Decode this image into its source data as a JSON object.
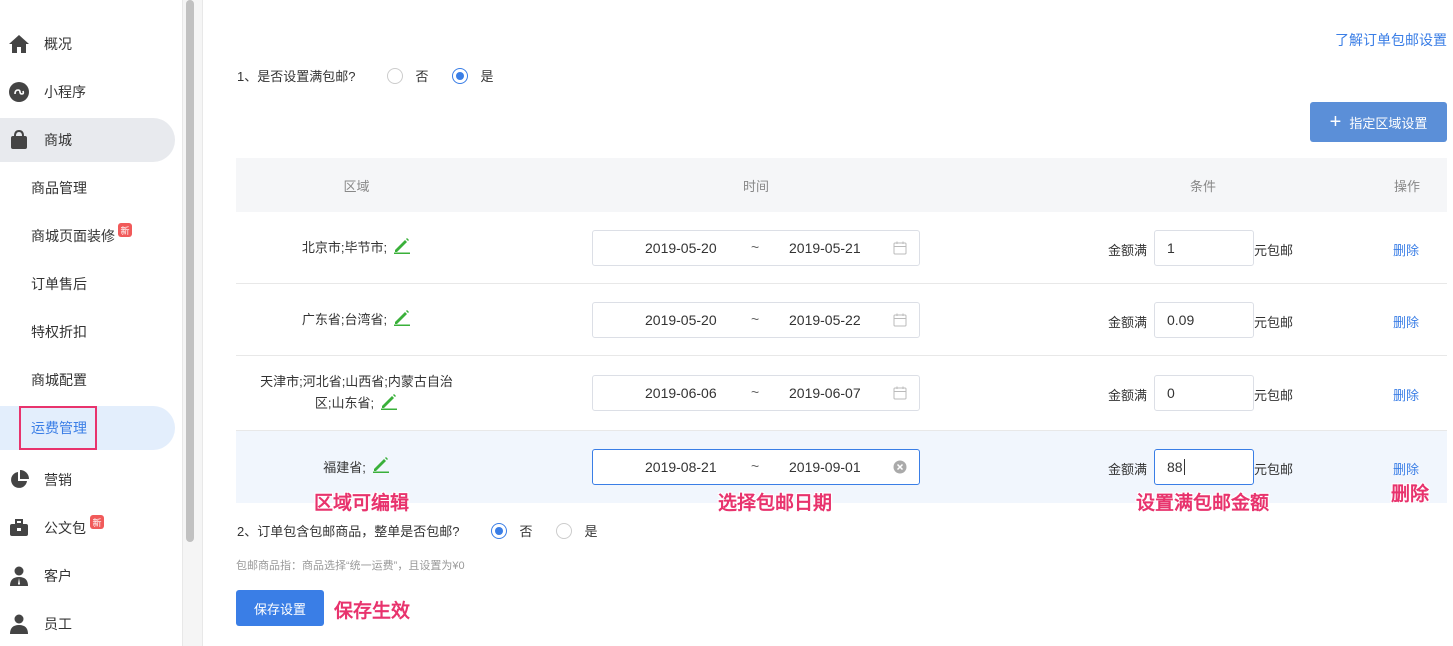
{
  "sidebar": {
    "items": [
      {
        "label": "概况",
        "icon": "home-icon"
      },
      {
        "label": "小程序",
        "icon": "miniprogram-icon"
      },
      {
        "label": "商城",
        "icon": "shopping-bag-icon"
      },
      {
        "label": "商品管理"
      },
      {
        "label": "商城页面装修",
        "badge": "新"
      },
      {
        "label": "订单售后"
      },
      {
        "label": "特权折扣"
      },
      {
        "label": "商城配置"
      },
      {
        "label": "运费管理"
      },
      {
        "label": "营销",
        "icon": "pie-chart-icon"
      },
      {
        "label": "公文包",
        "badge": "新",
        "icon": "briefcase-icon"
      },
      {
        "label": "客户",
        "icon": "customer-icon"
      },
      {
        "label": "员工",
        "icon": "employee-icon"
      }
    ]
  },
  "header": {
    "help_link": "了解订单包邮设置"
  },
  "q1": {
    "label": "1、是否设置满包邮?",
    "opt_no": "否",
    "opt_yes": "是",
    "selected": "是"
  },
  "add_region_button": "指定区域设置",
  "table": {
    "headers": {
      "region": "区域",
      "time": "时间",
      "condition": "条件",
      "action": "操作"
    },
    "rows": [
      {
        "region": "北京市;毕节市;",
        "start": "2019-05-20",
        "end": "2019-05-21",
        "cond_label": "金额满",
        "amount": "1",
        "unit": "元包邮",
        "action": "删除"
      },
      {
        "region": "广东省;台湾省;",
        "start": "2019-05-20",
        "end": "2019-05-22",
        "cond_label": "金额满",
        "amount": "0.09",
        "unit": "元包邮",
        "action": "删除"
      },
      {
        "region_line1": "天津市;河北省;山西省;内蒙古自治",
        "region_line2": "区;山东省;",
        "start": "2019-06-06",
        "end": "2019-06-07",
        "cond_label": "金额满",
        "amount": "0",
        "unit": "元包邮",
        "action": "删除"
      },
      {
        "region": "福建省;",
        "start": "2019-08-21",
        "end": "2019-09-01",
        "cond_label": "金额满",
        "amount": "88",
        "unit": "元包邮",
        "action": "删除"
      }
    ],
    "date_separator": "~"
  },
  "q2": {
    "label": "2、订单包含包邮商品，整单是否包邮?",
    "opt_no": "否",
    "opt_yes": "是",
    "selected": "否"
  },
  "note": "包邮商品指：商品选择“统一运费”，且设置为¥0",
  "save_button": "保存设置",
  "annotations": {
    "region_editable": "区域可编辑",
    "choose_date": "选择包邮日期",
    "set_amount": "设置满包邮金额",
    "delete": "删除",
    "save_effect": "保存生效"
  },
  "colors": {
    "accent": "#3a7ee6",
    "annotation": "#e8336d",
    "edit_icon": "#3ab03a"
  }
}
